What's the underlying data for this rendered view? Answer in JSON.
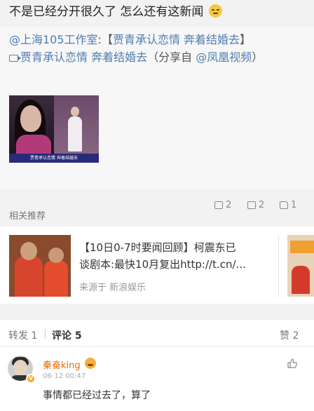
{
  "post": {
    "text": "不是已经分开很久了 怎么还有这新闻",
    "emoji_icon": "embarrassed-face-emoji"
  },
  "repost": {
    "author_mention": "@上海105工作室",
    "headline_prefix": ":【",
    "headline": "贾青承认恋情 奔着结婚去",
    "headline_suffix": "】",
    "link_text": "贾青承认恋情 奔着结婚去",
    "share_prefix": "（分享自 ",
    "share_source": "@凤凰视频",
    "share_suffix": "）",
    "video_caption": "贾青承认恋情 奔着结婚去",
    "counts": {
      "repost": "2",
      "comment": "2",
      "like": "1"
    }
  },
  "related": {
    "label": "相关推荐",
    "card": {
      "title_line1": "【10日0-7时要闻回顾】柯震东已",
      "title_line2": "谈剧本:最快10月复出http://t.cn/...",
      "source": "来源于 新浪娱乐"
    }
  },
  "tabs": {
    "repost": "转发 1",
    "comments": "评论 5",
    "likes": "赞 2"
  },
  "comment": {
    "user": "秦奋king",
    "badge_icon": "crown-face-badge",
    "verified": "V",
    "time": "06-12 00:47",
    "text": "事情都已经过去了，算了"
  },
  "colors": {
    "link": "#507daf",
    "username": "#e86b00",
    "background": "#f2f2f2"
  }
}
